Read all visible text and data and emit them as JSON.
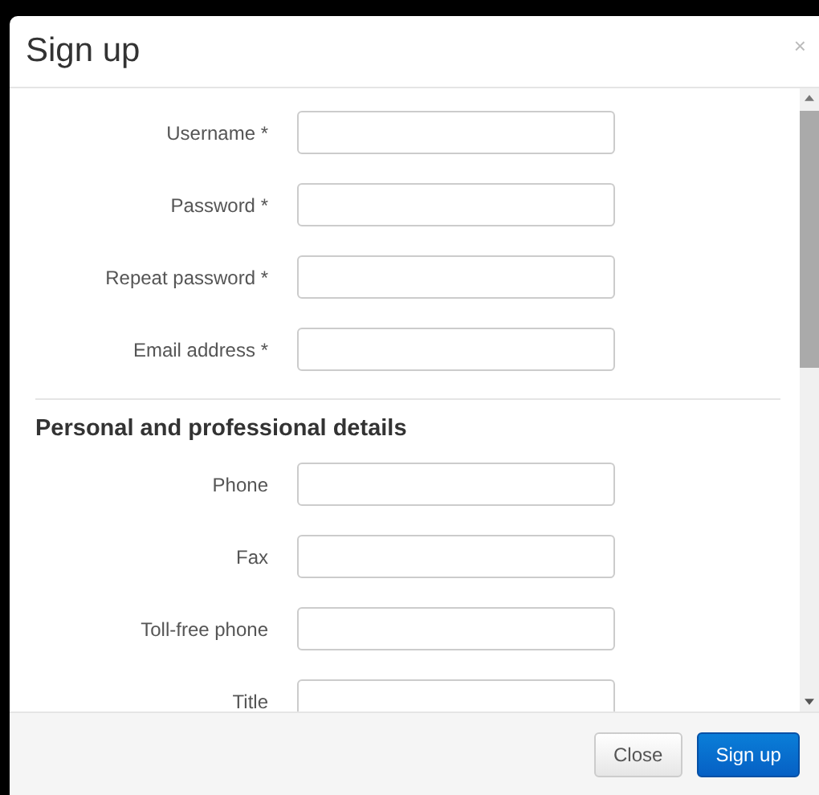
{
  "dialog": {
    "title": "Sign up",
    "close_glyph": "×"
  },
  "account_fields": [
    {
      "label": "Username *"
    },
    {
      "label": "Password *"
    },
    {
      "label": "Repeat password *"
    },
    {
      "label": "Email address *"
    }
  ],
  "details": {
    "heading": "Personal and professional details",
    "fields": [
      {
        "label": "Phone"
      },
      {
        "label": "Fax"
      },
      {
        "label": "Toll-free phone"
      },
      {
        "label": "Title"
      }
    ]
  },
  "buttons": [
    {
      "label": "Close",
      "kind": "default"
    },
    {
      "label": "Sign up",
      "kind": "primary"
    }
  ]
}
